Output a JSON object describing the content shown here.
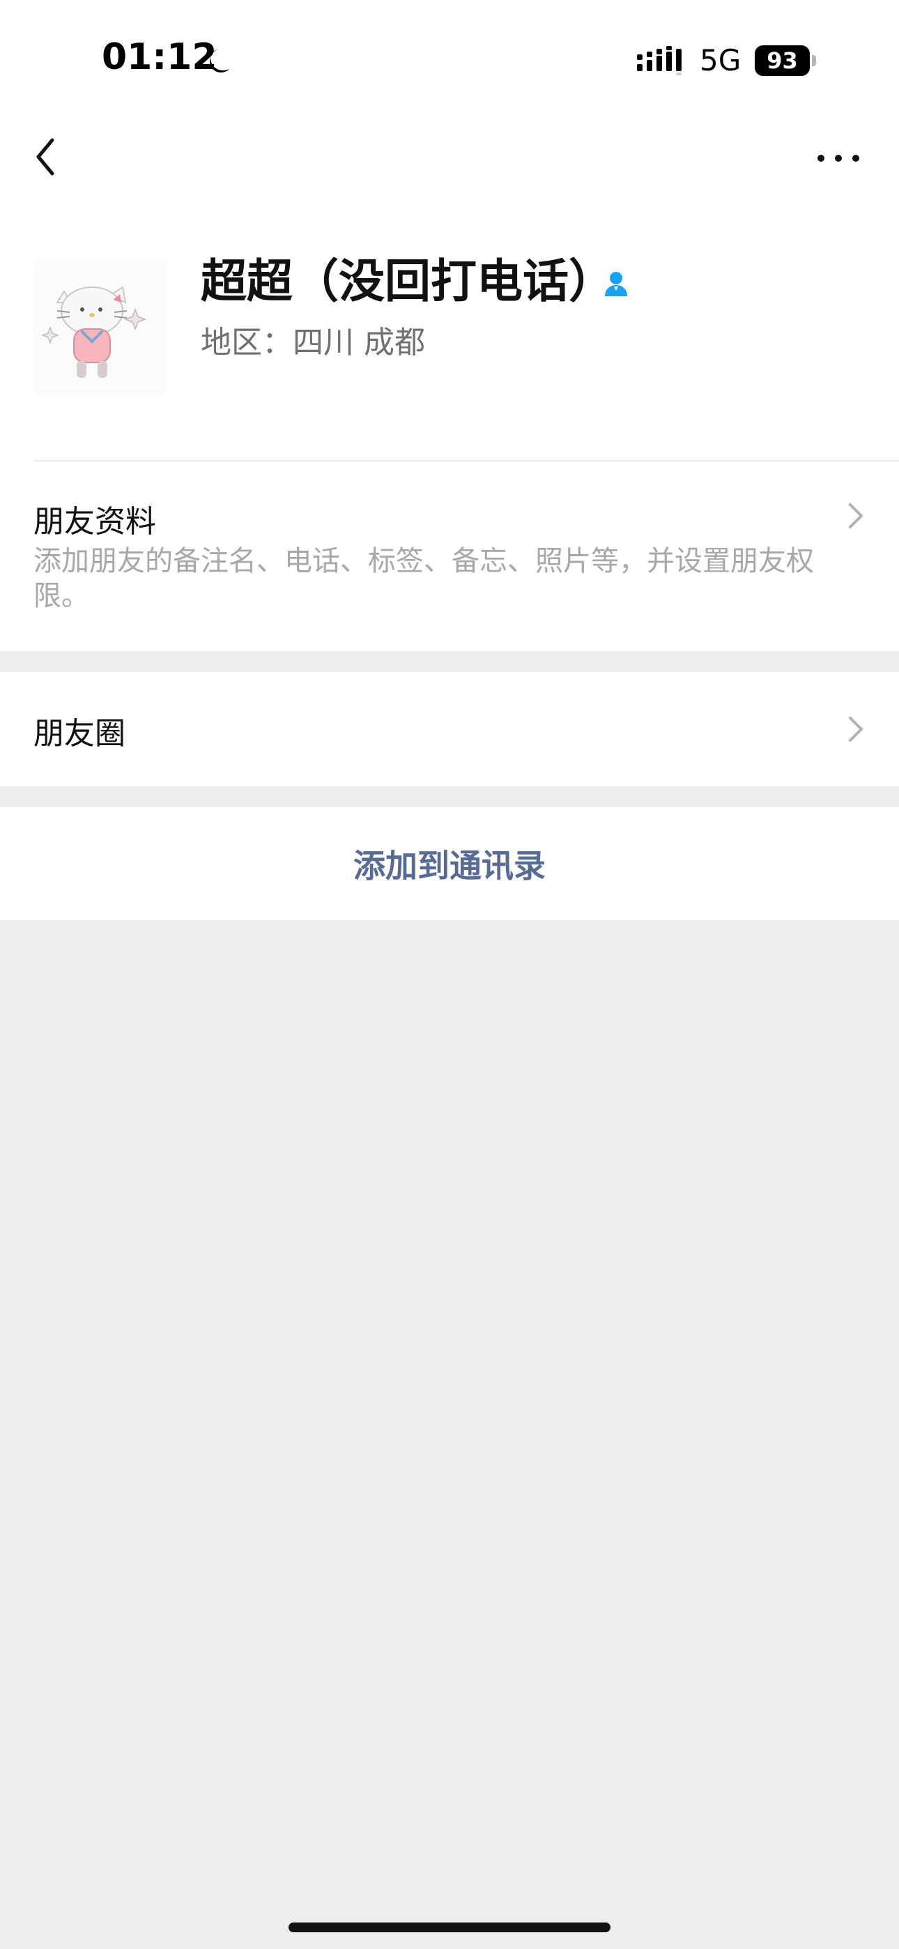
{
  "status_bar": {
    "time": "01:12",
    "network": "5G",
    "battery": "93",
    "icons": {
      "moon": "moon-icon",
      "signal": "signal-icon"
    }
  },
  "header": {
    "back_icon": "back-icon",
    "more_icon": "more-icon"
  },
  "profile": {
    "name": "超超（没回打电话）",
    "region": "地区：四川 成都",
    "verified_icon": "person-icon",
    "avatar_icon": "hello-kitty-avatar"
  },
  "rows": {
    "friend_info": {
      "title": "朋友资料",
      "subtitle": "添加朋友的备注名、电话、标签、备忘、照片等，并设置朋友权限。"
    },
    "moments": {
      "title": "朋友圈"
    }
  },
  "actions": {
    "add_to_contacts": "添加到通讯录"
  },
  "colors": {
    "page_background": "#ededed",
    "surface": "#ffffff",
    "primary_text": "#111111",
    "secondary_text": "#707070",
    "hint_text": "#a8a8a8",
    "link_text": "#576b95",
    "accent_icon": "#1aa1f2"
  }
}
